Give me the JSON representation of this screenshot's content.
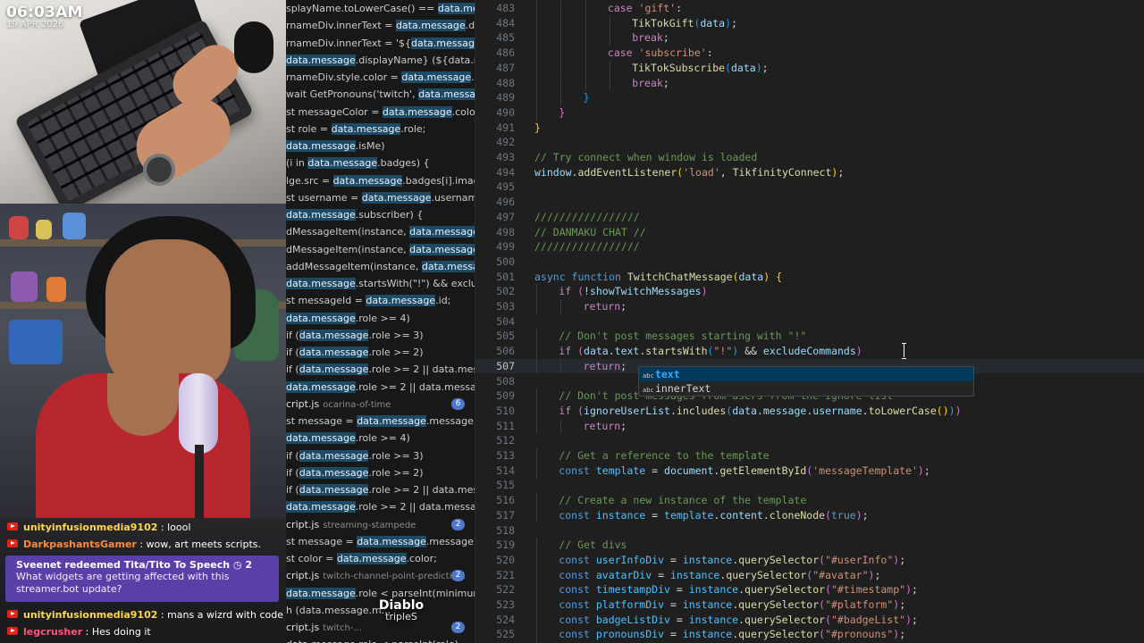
{
  "overlay": {
    "time": "06:03AM",
    "date": "19 APR 2026"
  },
  "chat": {
    "messages": [
      {
        "user": "unityinfusionmedia9102",
        "text": ": loool",
        "color": "#ffd84a"
      },
      {
        "user": "DarkpashantsGamer",
        "text": ": wow, art meets scripts.",
        "color": "#ff8a3d"
      },
      {
        "user": "unityinfusionmedia9102",
        "text": ": mans a wizrd with code",
        "color": "#ffd84a"
      },
      {
        "user": "legcrusher",
        "text": ": Hes doing it",
        "color": "#ff5577"
      }
    ],
    "redeem": {
      "title": "Sveenet redeemed Tita/Tito To Speech ◷ 2",
      "message": "What widgets are getting affected with this streamer.bot update?"
    }
  },
  "search_results": [
    {
      "pre": "splayName.toLowerCase() == ",
      "hl": "data.mess...",
      "post": ""
    },
    {
      "pre": "rnameDiv.innerText = ",
      "hl": "data.message",
      "post": ".disp..."
    },
    {
      "pre": "rnameDiv.innerText = '${",
      "hl": "data.message",
      "post": ".d..."
    },
    {
      "pre": "",
      "hl": "data.message",
      "post": ".displayName} (${data.messa..."
    },
    {
      "pre": "rnameDiv.style.color = ",
      "hl": "data.message",
      "post": ".color;"
    },
    {
      "pre": "wait GetPronouns('twitch', ",
      "hl": "data.message",
      "post": "...."
    },
    {
      "pre": "st messageColor = ",
      "hl": "data.message",
      "post": ".color;"
    },
    {
      "pre": "st role = ",
      "hl": "data.message",
      "post": ".role;"
    },
    {
      "pre": "",
      "hl": "data.message",
      "post": ".isMe)"
    },
    {
      "pre": "(i in ",
      "hl": "data.message",
      "post": ".badges) {"
    },
    {
      "pre": "lge.src = ",
      "hl": "data.message",
      "post": ".badges[i].image..."
    },
    {
      "pre": "st username = ",
      "hl": "data.message",
      "post": ".username;"
    },
    {
      "pre": "",
      "hl": "data.message",
      "post": ".subscriber) {"
    },
    {
      "pre": "dMessageItem(instance, ",
      "hl": "data.message",
      "post": ".m..."
    },
    {
      "pre": "dMessageItem(instance, ",
      "hl": "data.message",
      "post": ".m..."
    },
    {
      "pre": "addMessageItem(instance, ",
      "hl": "data.message",
      "post": "...."
    },
    {
      "pre": "",
      "hl": "data.message",
      "post": ".startsWith(\"!\") && exclude..."
    },
    {
      "pre": "st messageId = ",
      "hl": "data.message",
      "post": ".id;"
    },
    {
      "pre": "",
      "hl": "data.message",
      "post": ".role >= 4)"
    },
    {
      "pre": " if (",
      "hl": "data.message",
      "post": ".role >= 3)"
    },
    {
      "pre": " if (",
      "hl": "data.message",
      "post": ".role >= 2)"
    },
    {
      "pre": " if (",
      "hl": "data.message",
      "post": ".role >= 2 || data.mess..."
    },
    {
      "pre": "",
      "hl": "data.message",
      "post": ".role >= 2 || data.message.s..."
    },
    {
      "file": "cript.js",
      "path": "ocarina-of-time",
      "badge": "6"
    },
    {
      "pre": "st message = ",
      "hl": "data.message",
      "post": ".message;"
    },
    {
      "pre": "",
      "hl": "data.message",
      "post": ".role >= 4)"
    },
    {
      "pre": " if (",
      "hl": "data.message",
      "post": ".role >= 3)"
    },
    {
      "pre": " if (",
      "hl": "data.message",
      "post": ".role >= 2)"
    },
    {
      "pre": " if (",
      "hl": "data.message",
      "post": ".role >= 2 || data.mess..."
    },
    {
      "pre": "",
      "hl": "data.message",
      "post": ".role >= 2 || data.message.s..."
    },
    {
      "file": "cript.js",
      "path": "streaming-stampede",
      "badge": "2"
    },
    {
      "pre": "st message = ",
      "hl": "data.message",
      "post": ".message;"
    },
    {
      "pre": "st color = ",
      "hl": "data.message",
      "post": ".color;"
    },
    {
      "file": "cript.js",
      "path": "twitch-channel-point-predictio...",
      "badge": "2"
    },
    {
      "pre": "",
      "hl": "data.message",
      "post": ".role < parseInt(minimumR..."
    },
    {
      "pre": "h (data.message.m...",
      "hl": "",
      "post": ""
    },
    {
      "file": "cript.js",
      "path": "twitch-...",
      "badge": "2"
    },
    {
      "pre": "data.message.role < parseInt(role)",
      "hl": "",
      "post": ""
    }
  ],
  "editor": {
    "active_line": "507",
    "lines": [
      {
        "n": "483",
        "indent": 3,
        "code": [
          [
            "kw",
            "case "
          ],
          [
            "str",
            "'gift'"
          ],
          [
            "",
            ":"
          ]
        ]
      },
      {
        "n": "484",
        "indent": 4,
        "code": [
          [
            "fn",
            "TikTokGift"
          ],
          [
            "br3",
            "("
          ],
          [
            "var",
            "data"
          ],
          [
            "br3",
            ")"
          ],
          [
            "",
            ";"
          ]
        ]
      },
      {
        "n": "485",
        "indent": 4,
        "code": [
          [
            "kw",
            "break"
          ],
          [
            "",
            ";"
          ]
        ]
      },
      {
        "n": "486",
        "indent": 3,
        "code": [
          [
            "kw",
            "case "
          ],
          [
            "str",
            "'subscribe'"
          ],
          [
            "",
            ":"
          ]
        ]
      },
      {
        "n": "487",
        "indent": 4,
        "code": [
          [
            "fn",
            "TikTokSubscribe"
          ],
          [
            "br3",
            "("
          ],
          [
            "var",
            "data"
          ],
          [
            "br3",
            ")"
          ],
          [
            "",
            ";"
          ]
        ]
      },
      {
        "n": "488",
        "indent": 4,
        "code": [
          [
            "kw",
            "break"
          ],
          [
            "",
            ";"
          ]
        ]
      },
      {
        "n": "489",
        "indent": 2,
        "code": [
          [
            "br3",
            "}"
          ]
        ]
      },
      {
        "n": "490",
        "indent": 1,
        "code": [
          [
            "br2",
            "}"
          ]
        ]
      },
      {
        "n": "491",
        "indent": 0,
        "code": [
          [
            "br1",
            "}"
          ]
        ]
      },
      {
        "n": "492",
        "indent": 0,
        "code": []
      },
      {
        "n": "493",
        "indent": 0,
        "code": [
          [
            "cm",
            "// Try connect when window is loaded"
          ]
        ]
      },
      {
        "n": "494",
        "indent": 0,
        "code": [
          [
            "var",
            "window"
          ],
          [
            "",
            "."
          ],
          [
            "fn",
            "addEventListener"
          ],
          [
            "br1",
            "("
          ],
          [
            "str",
            "'load'"
          ],
          [
            "",
            ", "
          ],
          [
            "fn",
            "TikfinityConnect"
          ],
          [
            "br1",
            ")"
          ],
          [
            "",
            ";"
          ]
        ]
      },
      {
        "n": "495",
        "indent": 0,
        "code": []
      },
      {
        "n": "496",
        "indent": 0,
        "code": []
      },
      {
        "n": "497",
        "indent": 0,
        "code": [
          [
            "cm",
            "/////////////////"
          ]
        ]
      },
      {
        "n": "498",
        "indent": 0,
        "code": [
          [
            "cm",
            "// DANMAKU CHAT //"
          ]
        ]
      },
      {
        "n": "499",
        "indent": 0,
        "code": [
          [
            "cm",
            "/////////////////"
          ]
        ]
      },
      {
        "n": "500",
        "indent": 0,
        "code": []
      },
      {
        "n": "501",
        "indent": 0,
        "code": [
          [
            "kb",
            "async "
          ],
          [
            "kb",
            "function "
          ],
          [
            "fn",
            "TwitchChatMessage"
          ],
          [
            "br1",
            "("
          ],
          [
            "var",
            "data"
          ],
          [
            "br1",
            ")"
          ],
          [
            "",
            " "
          ],
          [
            "br1",
            "{"
          ]
        ]
      },
      {
        "n": "502",
        "indent": 1,
        "code": [
          [
            "kw",
            "if "
          ],
          [
            "br2",
            "("
          ],
          [
            "",
            "!"
          ],
          [
            "var",
            "showTwitchMessages"
          ],
          [
            "br2",
            ")"
          ]
        ]
      },
      {
        "n": "503",
        "indent": 2,
        "code": [
          [
            "kw",
            "return"
          ],
          [
            "",
            ";"
          ]
        ]
      },
      {
        "n": "504",
        "indent": 0,
        "code": []
      },
      {
        "n": "505",
        "indent": 1,
        "code": [
          [
            "cm",
            "// Don't post messages starting with \"!\""
          ]
        ]
      },
      {
        "n": "506",
        "indent": 1,
        "code": [
          [
            "kw",
            "if "
          ],
          [
            "br2",
            "("
          ],
          [
            "var",
            "data"
          ],
          [
            "",
            "."
          ],
          [
            "var",
            "text"
          ],
          [
            "",
            "."
          ],
          [
            "fn",
            "startsWith"
          ],
          [
            "br3",
            "("
          ],
          [
            "str",
            "\"!\""
          ],
          [
            "br3",
            ")"
          ],
          [
            "",
            " && "
          ],
          [
            "var",
            "excludeCommands"
          ],
          [
            "br2",
            ")"
          ]
        ]
      },
      {
        "n": "507",
        "indent": 2,
        "code": [
          [
            "kw",
            "return"
          ],
          [
            "",
            ";"
          ]
        ]
      },
      {
        "n": "508",
        "indent": 0,
        "code": []
      },
      {
        "n": "509",
        "indent": 1,
        "code": [
          [
            "cm",
            "// Don't post messages from users from the ignore list"
          ]
        ]
      },
      {
        "n": "510",
        "indent": 1,
        "code": [
          [
            "kw",
            "if "
          ],
          [
            "br2",
            "("
          ],
          [
            "var",
            "ignoreUserList"
          ],
          [
            "",
            "."
          ],
          [
            "fn",
            "includes"
          ],
          [
            "br3",
            "("
          ],
          [
            "var",
            "data"
          ],
          [
            "",
            "."
          ],
          [
            "var",
            "message"
          ],
          [
            "",
            "."
          ],
          [
            "var",
            "username"
          ],
          [
            "",
            "."
          ],
          [
            "fn",
            "toLowerCase"
          ],
          [
            "br1",
            "()"
          ],
          [
            "br3",
            ")"
          ],
          [
            "br2",
            ")"
          ]
        ]
      },
      {
        "n": "511",
        "indent": 2,
        "code": [
          [
            "kw",
            "return"
          ],
          [
            "",
            ";"
          ]
        ]
      },
      {
        "n": "512",
        "indent": 0,
        "code": []
      },
      {
        "n": "513",
        "indent": 1,
        "code": [
          [
            "cm",
            "// Get a reference to the template"
          ]
        ]
      },
      {
        "n": "514",
        "indent": 1,
        "code": [
          [
            "kb",
            "const "
          ],
          [
            "cst",
            "template"
          ],
          [
            "",
            " = "
          ],
          [
            "var",
            "document"
          ],
          [
            "",
            "."
          ],
          [
            "fn",
            "getElementById"
          ],
          [
            "br2",
            "("
          ],
          [
            "str",
            "'messageTemplate'"
          ],
          [
            "br2",
            ")"
          ],
          [
            "",
            ";"
          ]
        ]
      },
      {
        "n": "515",
        "indent": 0,
        "code": []
      },
      {
        "n": "516",
        "indent": 1,
        "code": [
          [
            "cm",
            "// Create a new instance of the template"
          ]
        ]
      },
      {
        "n": "517",
        "indent": 1,
        "code": [
          [
            "kb",
            "const "
          ],
          [
            "cst",
            "instance"
          ],
          [
            "",
            " = "
          ],
          [
            "cst",
            "template"
          ],
          [
            "",
            "."
          ],
          [
            "var",
            "content"
          ],
          [
            "",
            "."
          ],
          [
            "fn",
            "cloneNode"
          ],
          [
            "br2",
            "("
          ],
          [
            "kb",
            "true"
          ],
          [
            "br2",
            ")"
          ],
          [
            "",
            ";"
          ]
        ]
      },
      {
        "n": "518",
        "indent": 0,
        "code": []
      },
      {
        "n": "519",
        "indent": 1,
        "code": [
          [
            "cm",
            "// Get divs"
          ]
        ]
      },
      {
        "n": "520",
        "indent": 1,
        "code": [
          [
            "kb",
            "const "
          ],
          [
            "cst",
            "userInfoDiv"
          ],
          [
            "",
            " = "
          ],
          [
            "cst",
            "instance"
          ],
          [
            "",
            "."
          ],
          [
            "fn",
            "querySelector"
          ],
          [
            "br2",
            "("
          ],
          [
            "str",
            "\"#userInfo\""
          ],
          [
            "br2",
            ")"
          ],
          [
            "",
            ";"
          ]
        ]
      },
      {
        "n": "521",
        "indent": 1,
        "code": [
          [
            "kb",
            "const "
          ],
          [
            "cst",
            "avatarDiv"
          ],
          [
            "",
            " = "
          ],
          [
            "cst",
            "instance"
          ],
          [
            "",
            "."
          ],
          [
            "fn",
            "querySelector"
          ],
          [
            "br2",
            "("
          ],
          [
            "str",
            "\"#avatar\""
          ],
          [
            "br2",
            ")"
          ],
          [
            "",
            ";"
          ]
        ]
      },
      {
        "n": "522",
        "indent": 1,
        "code": [
          [
            "kb",
            "const "
          ],
          [
            "cst",
            "timestampDiv"
          ],
          [
            "",
            " = "
          ],
          [
            "cst",
            "instance"
          ],
          [
            "",
            "."
          ],
          [
            "fn",
            "querySelector"
          ],
          [
            "br2",
            "("
          ],
          [
            "str",
            "\"#timestamp\""
          ],
          [
            "br2",
            ")"
          ],
          [
            "",
            ";"
          ]
        ]
      },
      {
        "n": "523",
        "indent": 1,
        "code": [
          [
            "kb",
            "const "
          ],
          [
            "cst",
            "platformDiv"
          ],
          [
            "",
            " = "
          ],
          [
            "cst",
            "instance"
          ],
          [
            "",
            "."
          ],
          [
            "fn",
            "querySelector"
          ],
          [
            "br2",
            "("
          ],
          [
            "str",
            "\"#platform\""
          ],
          [
            "br2",
            ")"
          ],
          [
            "",
            ";"
          ]
        ]
      },
      {
        "n": "524",
        "indent": 1,
        "code": [
          [
            "kb",
            "const "
          ],
          [
            "cst",
            "badgeListDiv"
          ],
          [
            "",
            " = "
          ],
          [
            "cst",
            "instance"
          ],
          [
            "",
            "."
          ],
          [
            "fn",
            "querySelector"
          ],
          [
            "br2",
            "("
          ],
          [
            "str",
            "\"#badgeList\""
          ],
          [
            "br2",
            ")"
          ],
          [
            "",
            ";"
          ]
        ]
      },
      {
        "n": "525",
        "indent": 1,
        "code": [
          [
            "kb",
            "const "
          ],
          [
            "cst",
            "pronounsDiv"
          ],
          [
            "",
            " = "
          ],
          [
            "cst",
            "instance"
          ],
          [
            "",
            "."
          ],
          [
            "fn",
            "querySelector"
          ],
          [
            "br2",
            "("
          ],
          [
            "str",
            "\"#pronouns\""
          ],
          [
            "br2",
            ")"
          ],
          [
            "",
            ";"
          ]
        ]
      }
    ],
    "suggestions": [
      {
        "icon": "abc",
        "match": "text",
        "rest": ""
      },
      {
        "icon": "abc",
        "match": "",
        "rest": "innerText"
      }
    ]
  },
  "caption": {
    "name": "Diablo",
    "sub": "tripleS"
  }
}
